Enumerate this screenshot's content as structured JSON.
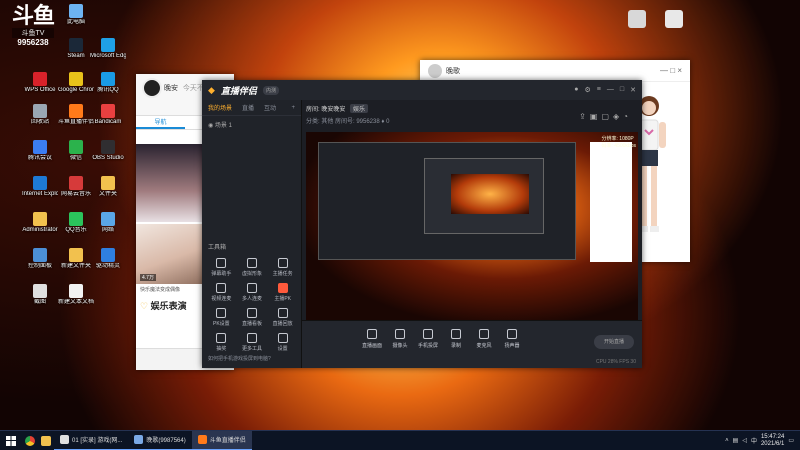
{
  "watermark": {
    "logo": "斗鱼",
    "text": "斗鱼TV",
    "room_id": "9956238"
  },
  "desktop_icons": [
    {
      "label": "此电脑",
      "color": "#6db3f2"
    },
    {
      "label": "Steam",
      "color": "#1b2838"
    },
    {
      "label": "Microsoft Edge",
      "color": "#1fa0e6"
    },
    {
      "label": "WPS Office",
      "color": "#d8222a"
    },
    {
      "label": "Google Chrome",
      "color": "#e8c21a"
    },
    {
      "label": "腾讯QQ",
      "color": "#1a9be6"
    },
    {
      "label": "回收站",
      "color": "#9aa6b3"
    },
    {
      "label": "斗鱼直播伴侣",
      "color": "#ff7a1a"
    },
    {
      "label": "Bandicam",
      "color": "#e94040"
    },
    {
      "label": "腾讯会议",
      "color": "#3b7df2"
    },
    {
      "label": "微信",
      "color": "#2bb24c"
    },
    {
      "label": "OBS Studio",
      "color": "#302e31"
    },
    {
      "label": "Internet Explorer",
      "color": "#1e7ad6"
    },
    {
      "label": "网易云音乐",
      "color": "#d63a3a"
    },
    {
      "label": "文件夹",
      "color": "#f2c14e"
    },
    {
      "label": "Administrator",
      "color": "#f2c14e"
    },
    {
      "label": "QQ音乐",
      "color": "#2bc45c"
    },
    {
      "label": "网络",
      "color": "#5aa6e6"
    },
    {
      "label": "控制面板",
      "color": "#4c8fd6"
    },
    {
      "label": "新建文件夹",
      "color": "#f2c14e"
    },
    {
      "label": "驱动精灵",
      "color": "#2f7fe0"
    },
    {
      "label": "截图",
      "color": "#e0e0e0"
    },
    {
      "label": "新建文本文档",
      "color": "#f2f2f2"
    }
  ],
  "chat_window": {
    "username": "晚安",
    "subtitle": "今天不闹",
    "tabs": [
      "导航",
      "热门"
    ],
    "badge": "4.7万",
    "caption": "快乐魔法变成偶像",
    "promo": "娱乐表演"
  },
  "char_window": {
    "title": "晚歌",
    "controls": "— □ ×"
  },
  "app": {
    "brand": "直播伴侣",
    "brand_tag": "内测",
    "side_tabs": [
      "我的场景",
      "直播",
      "互动"
    ],
    "scene": "场景 1",
    "tools_title": "工具箱",
    "tools": [
      {
        "label": "弹幕助手",
        "hot": false
      },
      {
        "label": "虚拟形象",
        "hot": false
      },
      {
        "label": "主播任务",
        "hot": false
      },
      {
        "label": "视频连麦",
        "hot": false
      },
      {
        "label": "多人连麦",
        "hot": false
      },
      {
        "label": "主播PK",
        "hot": true
      },
      {
        "label": "PK设置",
        "hot": false
      },
      {
        "label": "直播看板",
        "hot": false
      },
      {
        "label": "直播回放",
        "hot": false
      },
      {
        "label": "抽奖",
        "hot": false
      },
      {
        "label": "更多工具",
        "hot": false
      },
      {
        "label": "设置",
        "hot": false
      }
    ],
    "side_foot": "如何把手机游戏投屏到电脑?",
    "room_title": "房间: 晚安晚安",
    "room_tag": "娱乐",
    "room_info": "分类: 其他  房间号: 9956238  ♦ 0",
    "live_note": "分辨率: 1080P\n码率: 4500kbps",
    "bottom_items": [
      "直播画面",
      "摄像头",
      "手机投屏",
      "录制",
      "麦克风",
      "扬声器"
    ],
    "start_label": "开始直播",
    "stats": "CPU 28%  FPS 30"
  },
  "taskbar": {
    "tasks": [
      {
        "label": "01 [实录] 游戏(网...",
        "color": "#e0e0e0",
        "active": false
      },
      {
        "label": "晚歌(9987564)",
        "color": "#7aa9e6",
        "active": false
      },
      {
        "label": "斗鱼直播伴侣",
        "color": "#ff7a1a",
        "active": true
      }
    ],
    "tray_lang": "中",
    "time": "15:47:24",
    "date": "2021/6/1"
  }
}
